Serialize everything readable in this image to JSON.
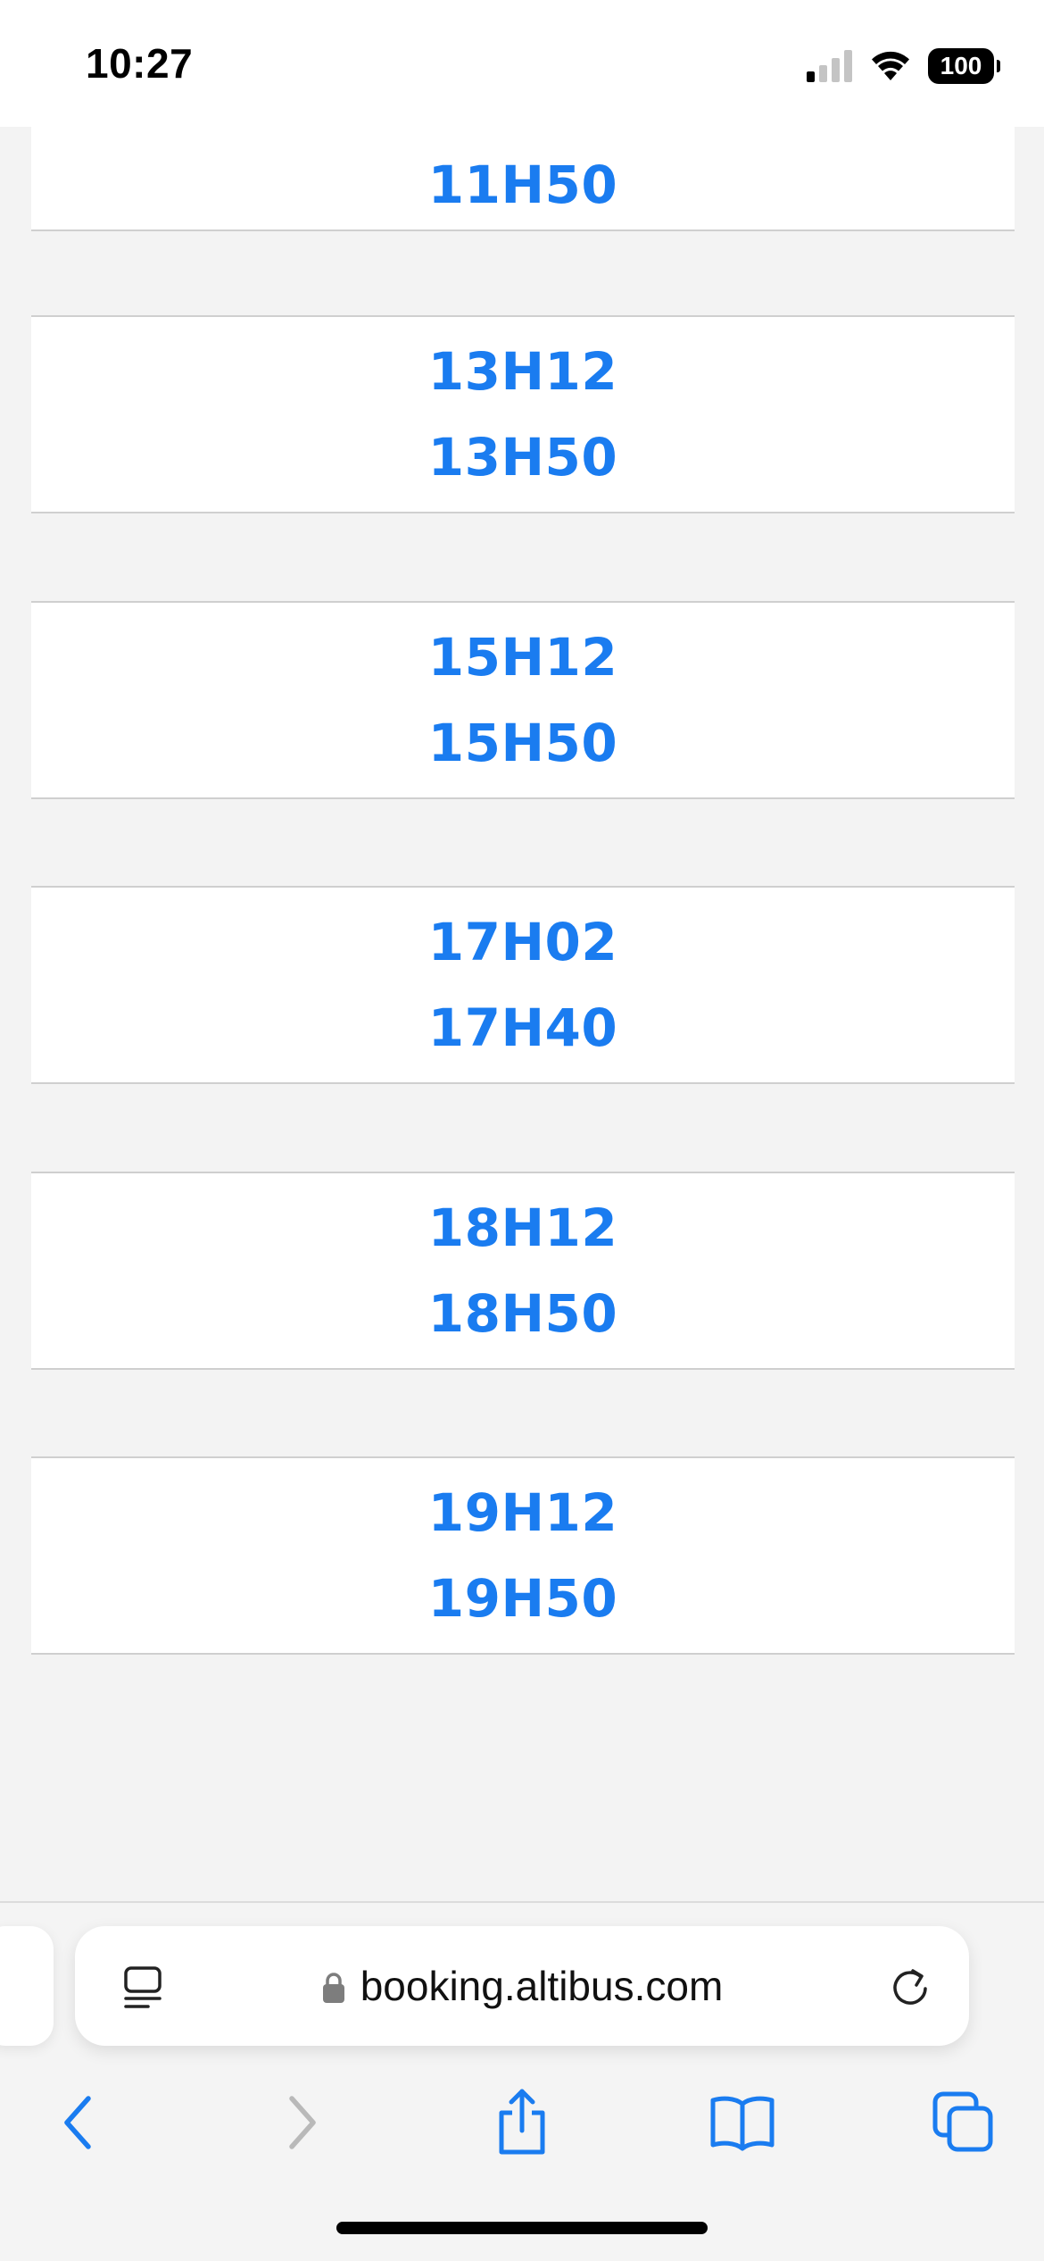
{
  "status_bar": {
    "time": "10:27",
    "battery": "100"
  },
  "departures": [
    {
      "times": [
        "11H50"
      ]
    },
    {
      "times": [
        "13H12",
        "13H50"
      ]
    },
    {
      "times": [
        "15H12",
        "15H50"
      ]
    },
    {
      "times": [
        "17H02",
        "17H40"
      ]
    },
    {
      "times": [
        "18H12",
        "18H50"
      ]
    },
    {
      "times": [
        "19H12",
        "19H50"
      ]
    }
  ],
  "browser": {
    "url": "booking.altibus.com",
    "icons": {
      "reader": "page-menu-icon",
      "lock": "lock-icon",
      "reload": "reload-icon",
      "back": "chevron-left-icon",
      "forward": "chevron-right-icon",
      "share": "share-icon",
      "bookmarks": "book-icon",
      "tabs": "tabs-icon"
    },
    "colors": {
      "accent": "#1a7cf0",
      "link_time": "#1a7cf0"
    }
  }
}
